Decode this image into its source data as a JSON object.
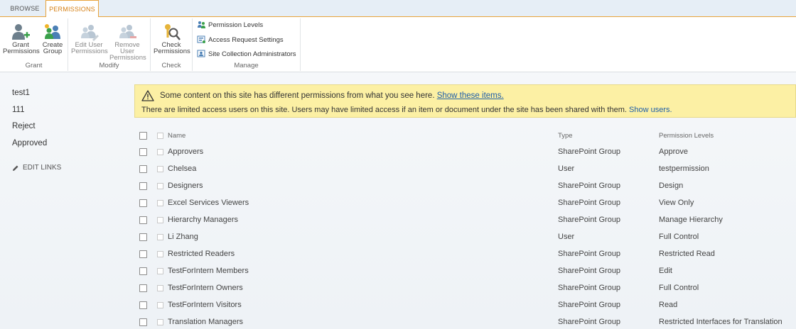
{
  "tabs": [
    {
      "label": "BROWSE",
      "active": false
    },
    {
      "label": "PERMISSIONS",
      "active": true
    }
  ],
  "ribbon": {
    "groups": {
      "grant": {
        "label": "Grant",
        "buttons": [
          {
            "line1": "Grant",
            "line2": "Permissions",
            "icon": "grant-permissions-icon"
          },
          {
            "line1": "Create",
            "line2": "Group",
            "icon": "create-group-icon"
          }
        ]
      },
      "modify": {
        "label": "Modify",
        "buttons": [
          {
            "line1": "Edit User",
            "line2": "Permissions",
            "icon": "edit-user-permissions-icon"
          },
          {
            "line1": "Remove User",
            "line2": "Permissions",
            "icon": "remove-user-permissions-icon"
          }
        ]
      },
      "check": {
        "label": "Check",
        "buttons": [
          {
            "line1": "Check",
            "line2": "Permissions",
            "icon": "check-permissions-icon"
          }
        ]
      },
      "manage": {
        "label": "Manage",
        "buttons": [
          {
            "label": "Permission Levels",
            "icon": "permission-levels-icon"
          },
          {
            "label": "Access Request Settings",
            "icon": "access-request-icon"
          },
          {
            "label": "Site Collection Administrators",
            "icon": "site-admins-icon"
          }
        ]
      }
    }
  },
  "leftnav": {
    "items": [
      "test1",
      "111",
      "Reject",
      "Approved"
    ],
    "edit_links": "EDIT LINKS"
  },
  "notice": {
    "line1_text": "Some content on this site has different permissions from what you see here.",
    "line1_link": "Show these items.",
    "line2_text": "There are limited access users on this site. Users may have limited access if an item or document under the site has been shared with them.",
    "line2_link": "Show users."
  },
  "table": {
    "headers": {
      "name": "Name",
      "type": "Type",
      "perm": "Permission Levels"
    },
    "rows": [
      {
        "name": "Approvers",
        "type": "SharePoint Group",
        "perm": "Approve"
      },
      {
        "name": "Chelsea",
        "type": "User",
        "perm": "testpermission"
      },
      {
        "name": "Designers",
        "type": "SharePoint Group",
        "perm": "Design"
      },
      {
        "name": "Excel Services Viewers",
        "type": "SharePoint Group",
        "perm": "View Only"
      },
      {
        "name": "Hierarchy Managers",
        "type": "SharePoint Group",
        "perm": "Manage Hierarchy"
      },
      {
        "name": "Li Zhang",
        "type": "User",
        "perm": "Full Control"
      },
      {
        "name": "Restricted Readers",
        "type": "SharePoint Group",
        "perm": "Restricted Read"
      },
      {
        "name": "TestForIntern Members",
        "type": "SharePoint Group",
        "perm": "Edit"
      },
      {
        "name": "TestForIntern Owners",
        "type": "SharePoint Group",
        "perm": "Full Control"
      },
      {
        "name": "TestForIntern Visitors",
        "type": "SharePoint Group",
        "perm": "Read"
      },
      {
        "name": "Translation Managers",
        "type": "SharePoint Group",
        "perm": "Restricted Interfaces for Translation"
      }
    ]
  },
  "colors": {
    "accent": "#e8a33b",
    "tab_active_text": "#d57f13",
    "notice_bg": "#fcf0a4",
    "link": "#1f5ea8"
  }
}
